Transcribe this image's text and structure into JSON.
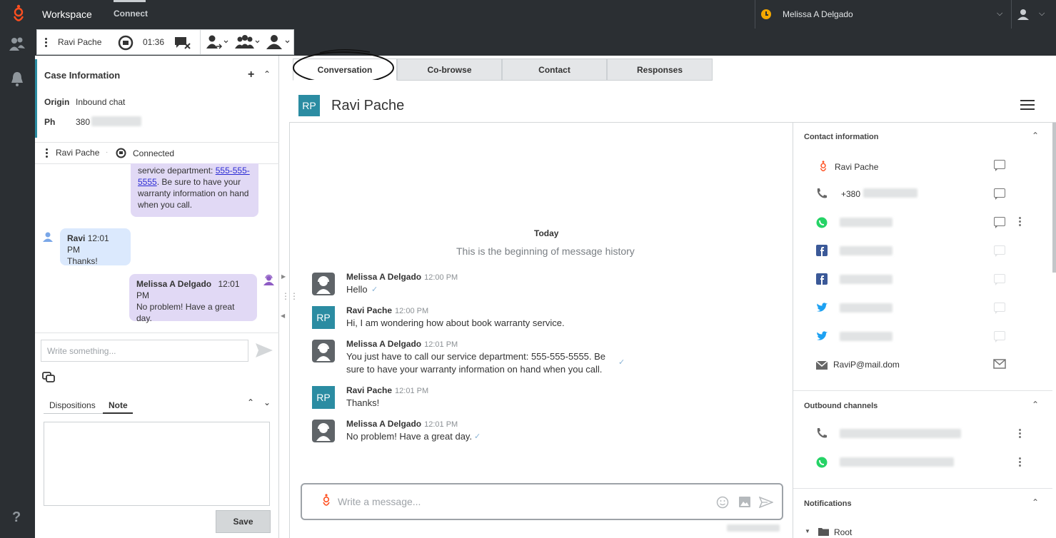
{
  "app": {
    "title": "Workspace",
    "nav_connect": "Connect",
    "agent_name": "Melissa A Delgado"
  },
  "toolbar": {
    "contact_name": "Ravi Pache",
    "timer": "01:36"
  },
  "case": {
    "title": "Case Information",
    "origin_label": "Origin",
    "origin_value": "Inbound chat",
    "ph_label": "Ph",
    "ph_value": "380"
  },
  "interaction": {
    "name": "Ravi Pache",
    "status": "Connected"
  },
  "left_chat": {
    "msg1_text_a": "service department: ",
    "msg1_link": "555-555-5555",
    "msg1_text_b": ". Be sure to have your warranty information on hand when you call.",
    "msg2_name": "Ravi",
    "msg2_time": "12:01 PM",
    "msg2_text": "Thanks!",
    "msg3_name": "Melissa A Delgado",
    "msg3_time": "12:01 PM",
    "msg3_text": "No problem! Have a great day.",
    "input_placeholder": "Write something..."
  },
  "dispositions": {
    "tab1": "Dispositions",
    "tab2": "Note",
    "save": "Save"
  },
  "tabs": [
    "Conversation",
    "Co-browse",
    "Contact",
    "Responses"
  ],
  "conversation": {
    "initials": "RP",
    "contact_name": "Ravi Pache",
    "day": "Today",
    "history_start": "This is the beginning of message history",
    "messages": [
      {
        "name": "Melissa A Delgado",
        "time": "12:00 PM",
        "text": "Hello",
        "type": "agent"
      },
      {
        "name": "Ravi Pache",
        "time": "12:00 PM",
        "text": "Hi, I am wondering how about book warranty service.",
        "type": "customer"
      },
      {
        "name": "Melissa A Delgado",
        "time": "12:01 PM",
        "text": "You just have to call our service department: 555-555-5555. Be sure to have your warranty information on hand when you call.",
        "type": "agent"
      },
      {
        "name": "Ravi Pache",
        "time": "12:01 PM",
        "text": "Thanks!",
        "type": "customer"
      },
      {
        "name": "Melissa A Delgado",
        "time": "12:01 PM",
        "text": "No problem! Have a great day.",
        "type": "agent"
      }
    ],
    "composer_placeholder": "Write a message..."
  },
  "contact_info": {
    "section_title": "Contact information",
    "name": "Ravi Pache",
    "phone": "+380",
    "email": "RaviP@mail.dom",
    "outbound_title": "Outbound channels",
    "notifications_title": "Notifications",
    "root": "Root"
  },
  "colors": {
    "accent": "#2b8ca2",
    "brand": "#ff4f1f",
    "agent_bubble": "#e1d9f5",
    "customer_bubble": "#dbe9fd",
    "topbar": "#2b2f33"
  }
}
